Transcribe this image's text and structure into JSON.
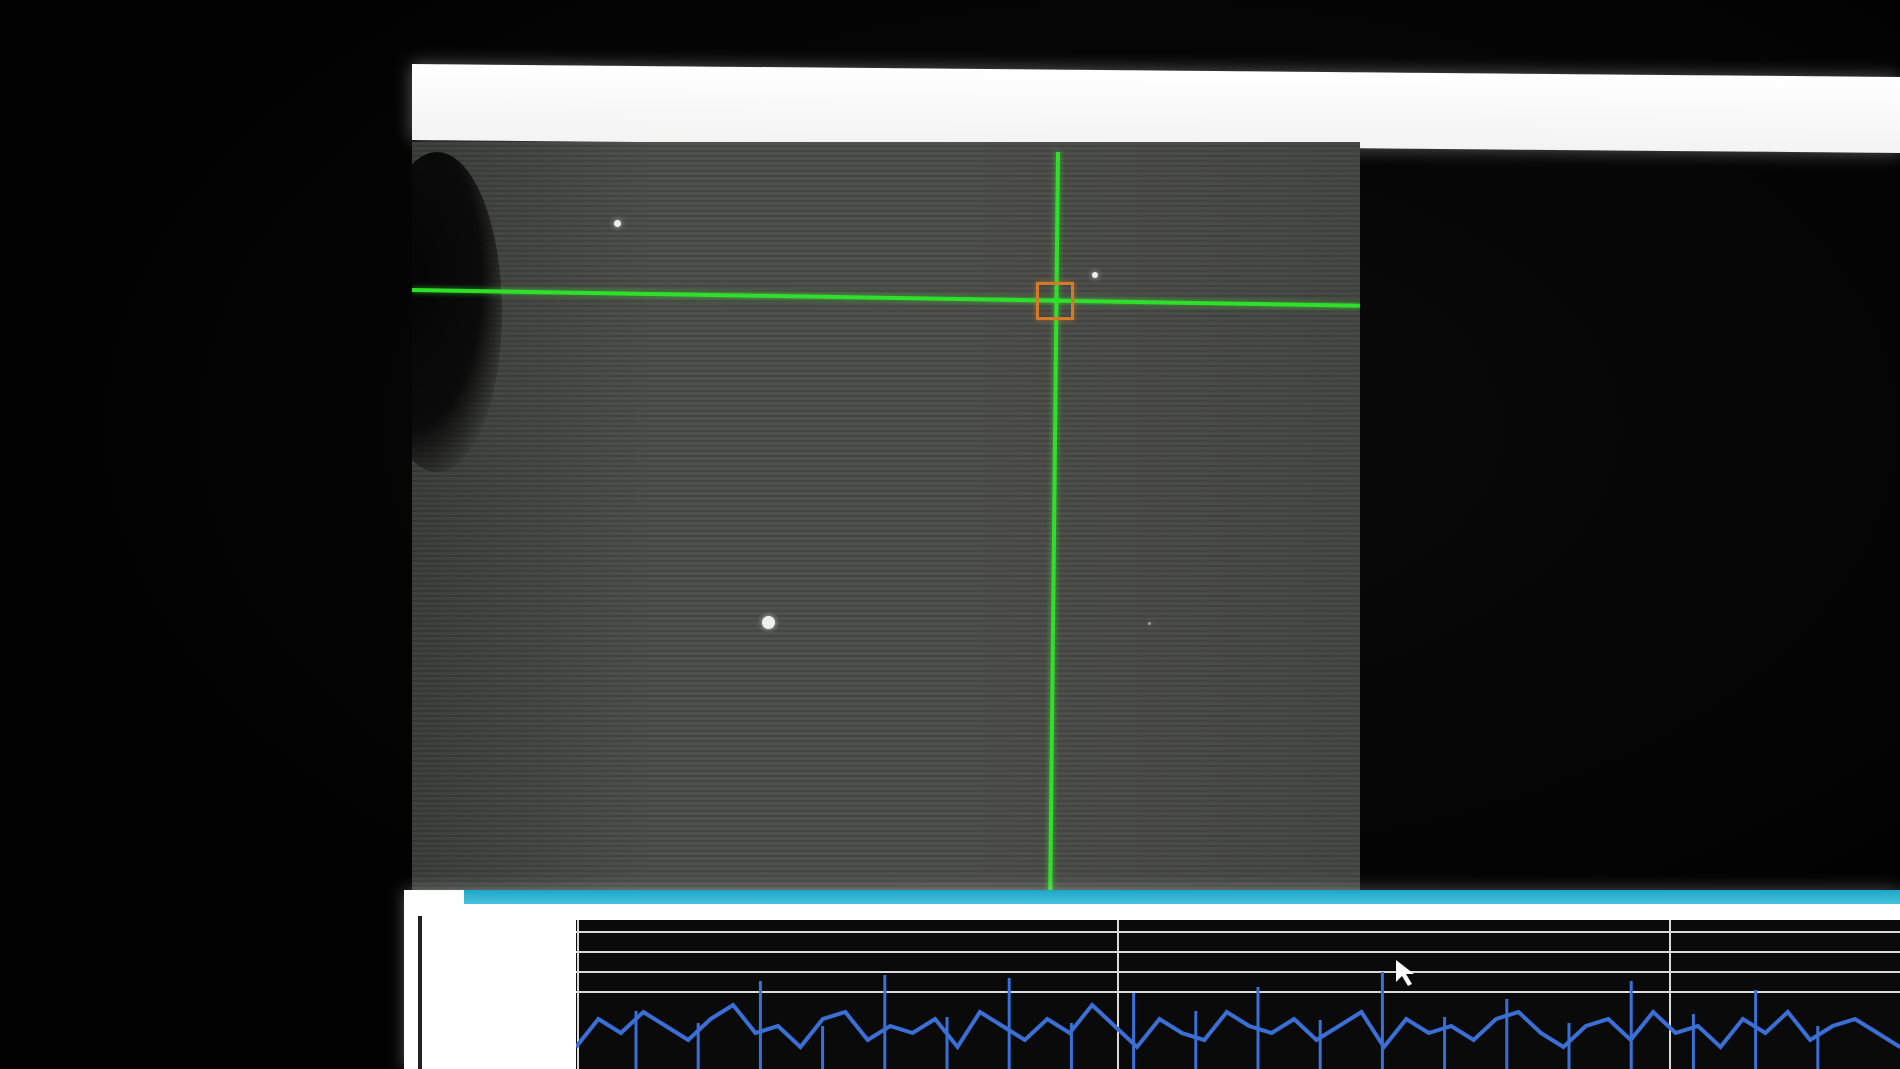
{
  "window": {
    "title": ""
  },
  "camera": {
    "crosshair_color": "#2ee02a",
    "target_color": "#d07a2a",
    "background_color": "#4a4c47"
  },
  "plot": {
    "line_color": "#3a6fd6",
    "grid_color": "#d9d9d9",
    "header_color": "#1ea6c8",
    "chart_data": {
      "type": "line",
      "title": "",
      "xlabel": "",
      "ylabel": "",
      "series": [
        {
          "values": [
            2,
            6,
            4,
            7,
            5,
            3,
            6,
            8,
            4,
            5,
            2,
            6,
            7,
            3,
            5,
            4,
            6,
            2,
            7,
            5,
            3,
            6,
            4,
            8,
            5,
            2,
            6,
            4,
            3,
            7,
            5,
            4,
            6,
            3,
            5,
            7,
            2,
            6,
            4,
            5,
            3,
            6,
            7,
            4,
            2,
            5,
            6,
            3,
            7,
            4,
            5,
            2,
            6,
            4,
            7,
            3,
            5,
            6,
            4,
            2
          ]
        }
      ],
      "spikes": [
        0.3,
        0.1,
        0.8,
        0.05,
        0.9,
        0.2,
        0.85,
        0.1,
        0.6,
        0.3,
        0.7,
        0.15,
        0.95,
        0.2,
        0.5,
        0.1,
        0.8,
        0.25,
        0.65,
        0.05
      ]
    }
  }
}
